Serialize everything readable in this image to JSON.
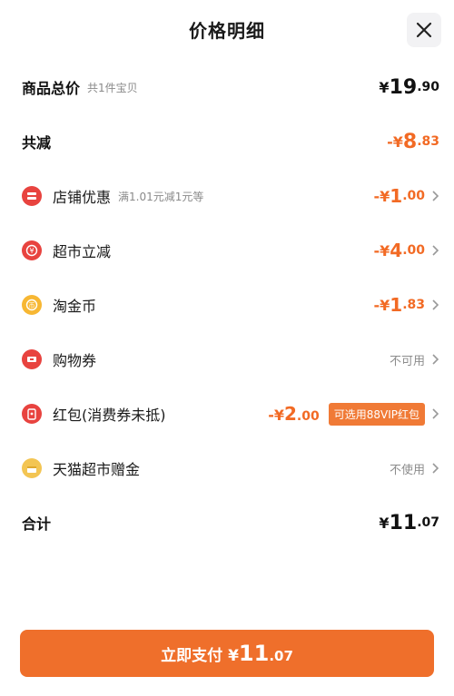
{
  "header": {
    "title": "价格明细"
  },
  "rows": {
    "total": {
      "label": "商品总价",
      "sub": "共1件宝贝",
      "yen": "¥",
      "int": "19",
      "dec": ".90"
    },
    "reduce": {
      "label": "共减",
      "sign": "-¥",
      "int": "8",
      "dec": ".83"
    },
    "store": {
      "label": "店铺优惠",
      "sub": "满1.01元减1元等",
      "sign": "-¥",
      "int": "1",
      "dec": ".00"
    },
    "market": {
      "label": "超市立减",
      "sign": "-¥",
      "int": "4",
      "dec": ".00"
    },
    "coin": {
      "label": "淘金币",
      "sign": "-¥",
      "int": "1",
      "dec": ".83"
    },
    "coupon": {
      "label": "购物券",
      "status": "不可用"
    },
    "redpack": {
      "label": "红包(消费券未抵)",
      "sign": "-¥",
      "int": "2",
      "dec": ".00",
      "badge": "可选用88VIP红包"
    },
    "gift": {
      "label": "天猫超市赠金",
      "status": "不使用"
    },
    "sum": {
      "label": "合计",
      "yen": "¥",
      "int": "11",
      "dec": ".07"
    }
  },
  "pay": {
    "label": "立即支付",
    "yen": "¥",
    "int": "11",
    "dec": ".07"
  },
  "colors": {
    "accent": "#ef6f2b",
    "red_icon": "#e8433f",
    "gold_icon": "#f7b733"
  }
}
